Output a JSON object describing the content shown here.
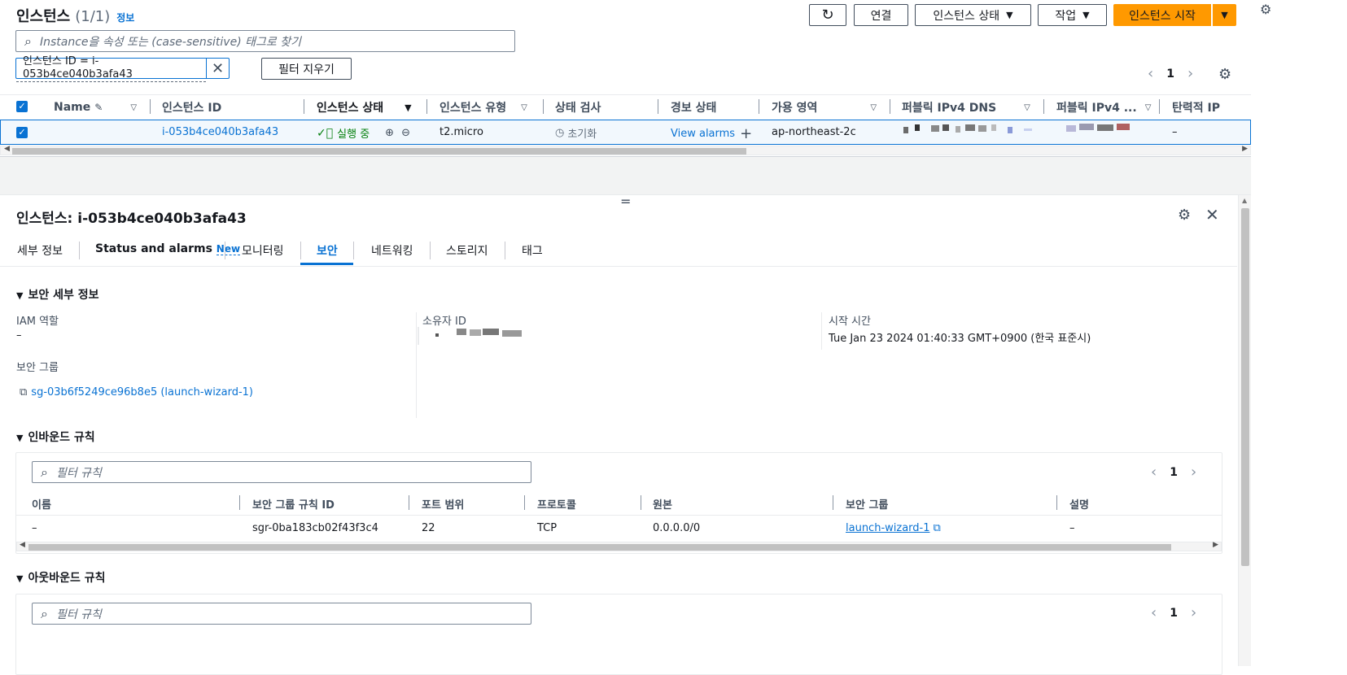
{
  "header": {
    "title": "인스턴스",
    "count": "(1/1)",
    "info_link": "정보",
    "buttons": {
      "connect": "연결",
      "instance_state": "인스턴스 상태",
      "actions": "작업",
      "launch": "인스턴스 시작"
    }
  },
  "search": {
    "placeholder": "Instance을 속성 또는 (case-sensitive) 태그로 찾기"
  },
  "filter": {
    "token": "인스턴스 ID = i-053b4ce040b3afa43",
    "clear_label": "필터 지우기"
  },
  "pagination": {
    "page": "1"
  },
  "table": {
    "columns": [
      "Name",
      "인스턴스 ID",
      "인스턴스 상태",
      "인스턴스 유형",
      "상태 검사",
      "경보 상태",
      "가용 영역",
      "퍼블릭 IPv4 DNS",
      "퍼블릭 IPv4 ...",
      "탄력적 IP"
    ],
    "row": {
      "instance_id": "i-053b4ce040b3afa43",
      "state": "실행 중",
      "type": "t2.micro",
      "status_check": "초기화",
      "alarm": "View alarms",
      "zone": "ap-northeast-2c",
      "elastic_ip": "–"
    }
  },
  "detail": {
    "title": "인스턴스: i-053b4ce040b3afa43",
    "tabs": [
      {
        "label": "세부 정보"
      },
      {
        "label": "Status and alarms",
        "badge": "New"
      },
      {
        "label": "모니터링"
      },
      {
        "label": "보안"
      },
      {
        "label": "네트워킹"
      },
      {
        "label": "스토리지"
      },
      {
        "label": "태그"
      }
    ],
    "active_tab": "보안",
    "security": {
      "section": "보안 세부 정보",
      "iam_label": "IAM 역할",
      "iam_value": "–",
      "owner_label": "소유자 ID",
      "launch_label": "시작 시간",
      "launch_value": "Tue Jan 23 2024 01:40:33 GMT+0900 (한국 표준시)",
      "sg_label": "보안 그룹",
      "sg_value": "sg-03b6f5249ce96b8e5 (launch-wizard-1)"
    },
    "inbound": {
      "section": "인바운드 규칙",
      "placeholder": "필터 규칙",
      "page": "1",
      "columns": [
        "이름",
        "보안 그룹 규칙 ID",
        "포트 범위",
        "프로토콜",
        "원본",
        "보안 그룹",
        "설명"
      ],
      "row": [
        "–",
        "sgr-0ba183cb02f43f3c4",
        "22",
        "TCP",
        "0.0.0.0/0",
        "launch-wizard-1",
        "–"
      ]
    },
    "outbound": {
      "section": "아웃바운드 규칙",
      "placeholder": "필터 규칙",
      "page": "1"
    }
  },
  "colors": {
    "primary": "#ff9900",
    "link": "#0972d3",
    "success": "#037f0c",
    "selected_row": "#f2f8fd"
  }
}
